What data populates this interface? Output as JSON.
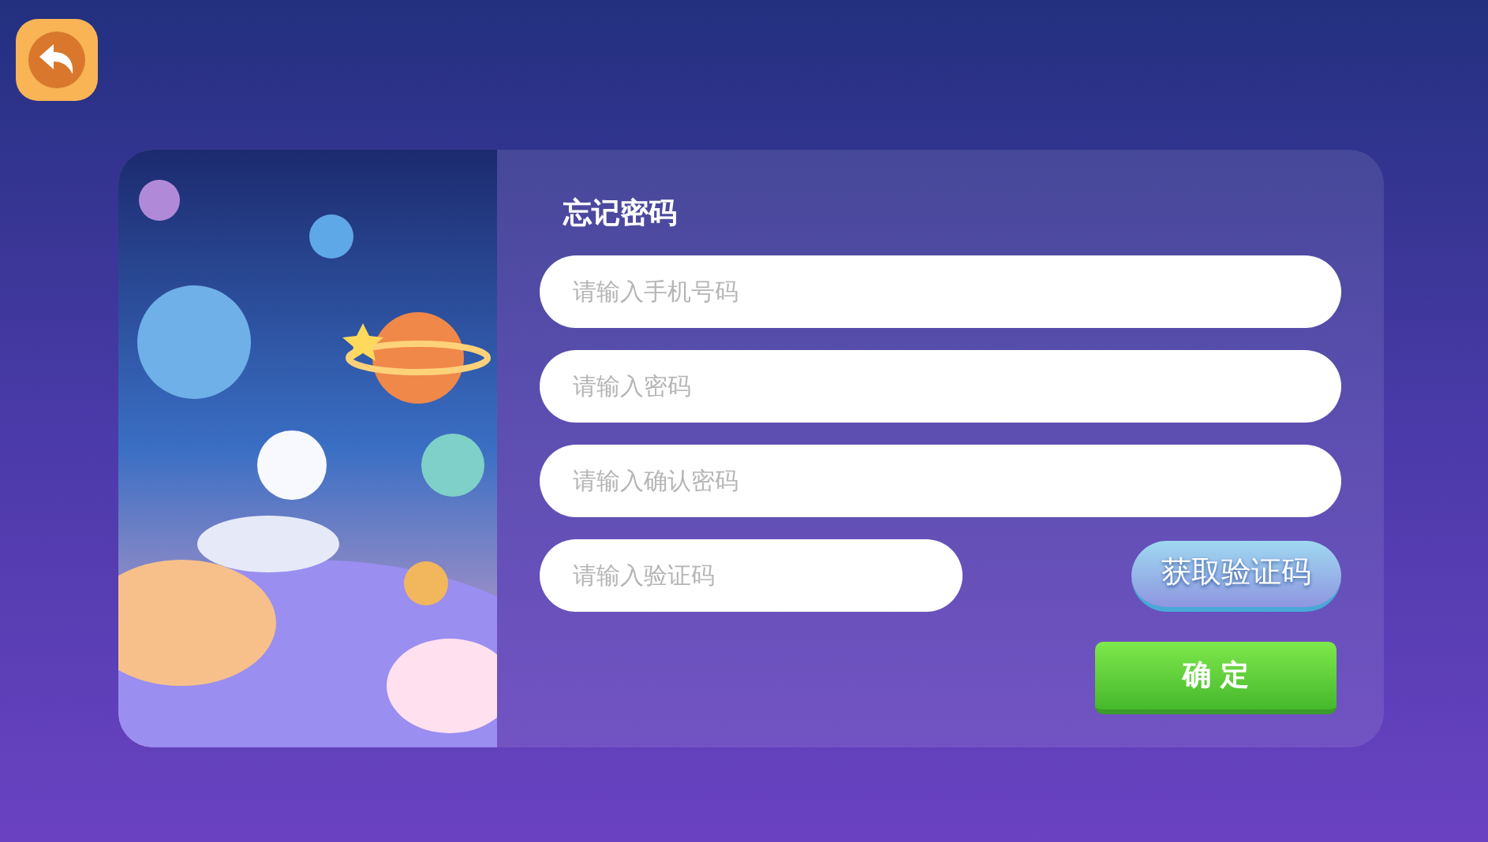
{
  "title": "忘记密码",
  "fields": [
    {
      "placeholder": "请输入手机号码"
    },
    {
      "placeholder": "请输入密码"
    },
    {
      "placeholder": "请输入确认密码"
    }
  ],
  "code_field": {
    "placeholder": "请输入验证码"
  },
  "get_code_button": "获取验证码",
  "confirm_button": "确 定"
}
